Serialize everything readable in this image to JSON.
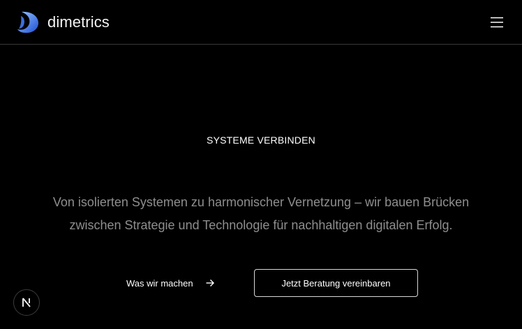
{
  "header": {
    "brand_name": "dimetrics",
    "logo_icon": "dimetrics-logo-icon",
    "menu_icon": "hamburger-menu-icon"
  },
  "hero": {
    "eyebrow": "SYSTEME VERBINDEN",
    "lead_line1": "Von isolierten Systemen zu harmonischer Vernetzung – wir bauen Brücken",
    "lead_line2": "zwischen Strategie und Technologie für nachhaltigen digitalen Erfolg."
  },
  "actions": {
    "secondary_label": "Was wir machen",
    "secondary_icon": "arrow-right-icon",
    "primary_label": "Jetzt Beratung vereinbaren"
  },
  "floating_badge": {
    "icon": "n-logo-icon"
  },
  "colors": {
    "background": "#000000",
    "text": "#ffffff",
    "muted_text": "#8e8e8e",
    "border": "#3a3a3a",
    "logo_blue_light": "#7fb4ff",
    "logo_blue_dark": "#1d4fd6"
  }
}
